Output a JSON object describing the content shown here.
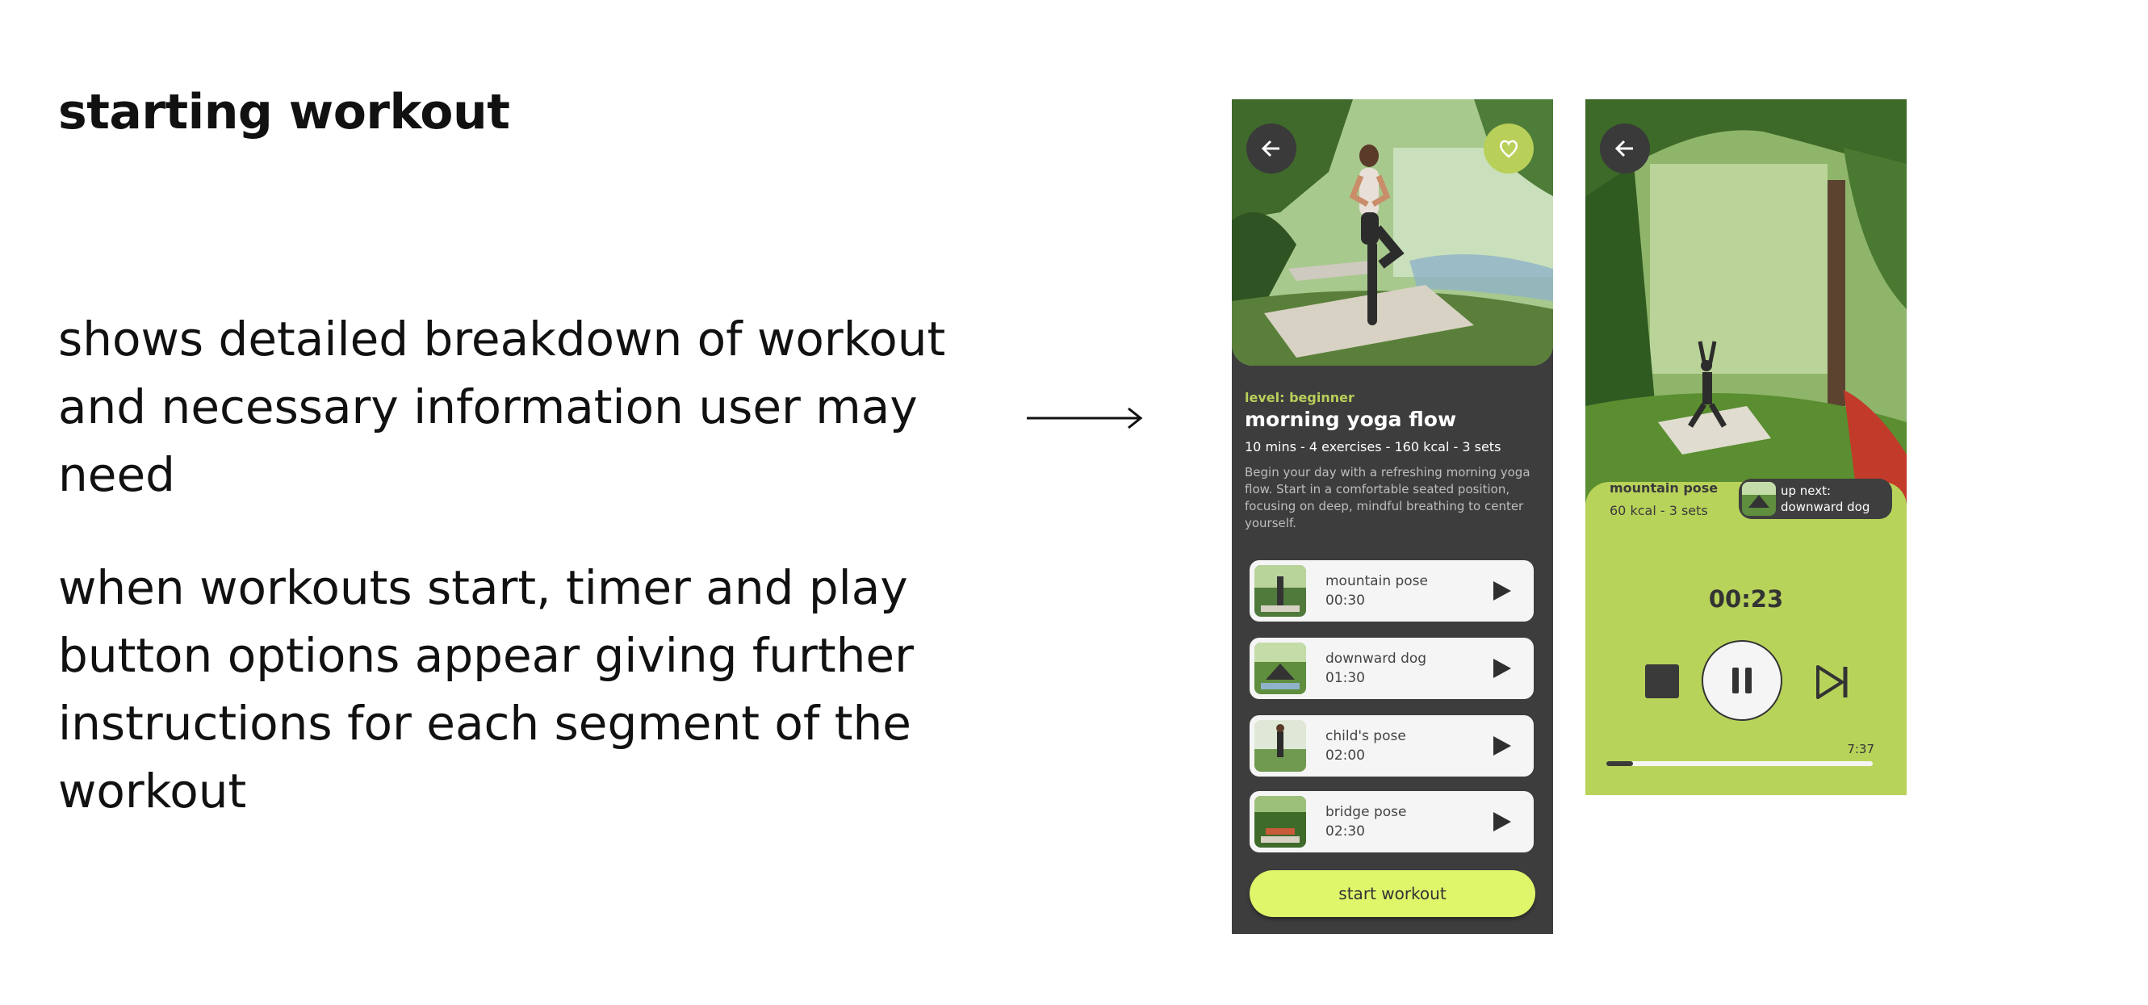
{
  "heading": "starting workout",
  "description_1": "shows detailed breakdown of workout and necessary information user may need",
  "description_2": "when workouts start, timer and play button options appear giving further instructions for each segment of the workout",
  "detail_screen": {
    "back_icon": "arrow-left-icon",
    "favorite_icon": "heart-icon",
    "level": "level: beginner",
    "title": "morning yoga flow",
    "meta": "10 mins - 4 exercises - 160 kcal - 3 sets",
    "description": "Begin your day with a refreshing morning yoga flow. Start in a comfortable seated position, focusing on deep, mindful breathing to center yourself.",
    "exercises": [
      {
        "name": "mountain pose",
        "time": "00:30"
      },
      {
        "name": "downward dog",
        "time": "01:30"
      },
      {
        "name": "child's pose",
        "time": "02:00"
      },
      {
        "name": "bridge pose",
        "time": "02:30"
      }
    ],
    "start_button": "start workout"
  },
  "player_screen": {
    "back_icon": "arrow-left-icon",
    "pose_name": "mountain pose",
    "pose_meta": "60 kcal - 3 sets",
    "up_next_label": "up next:",
    "up_next_value": "downward dog",
    "timer": "00:23",
    "total_time": "7:37",
    "progress_fraction": 0.1
  },
  "colors": {
    "accent_lime": "#b8cf5a",
    "button_lime": "#dff56a",
    "panel_green": "#b8d35a",
    "dark_bg": "#3d3d3d"
  }
}
